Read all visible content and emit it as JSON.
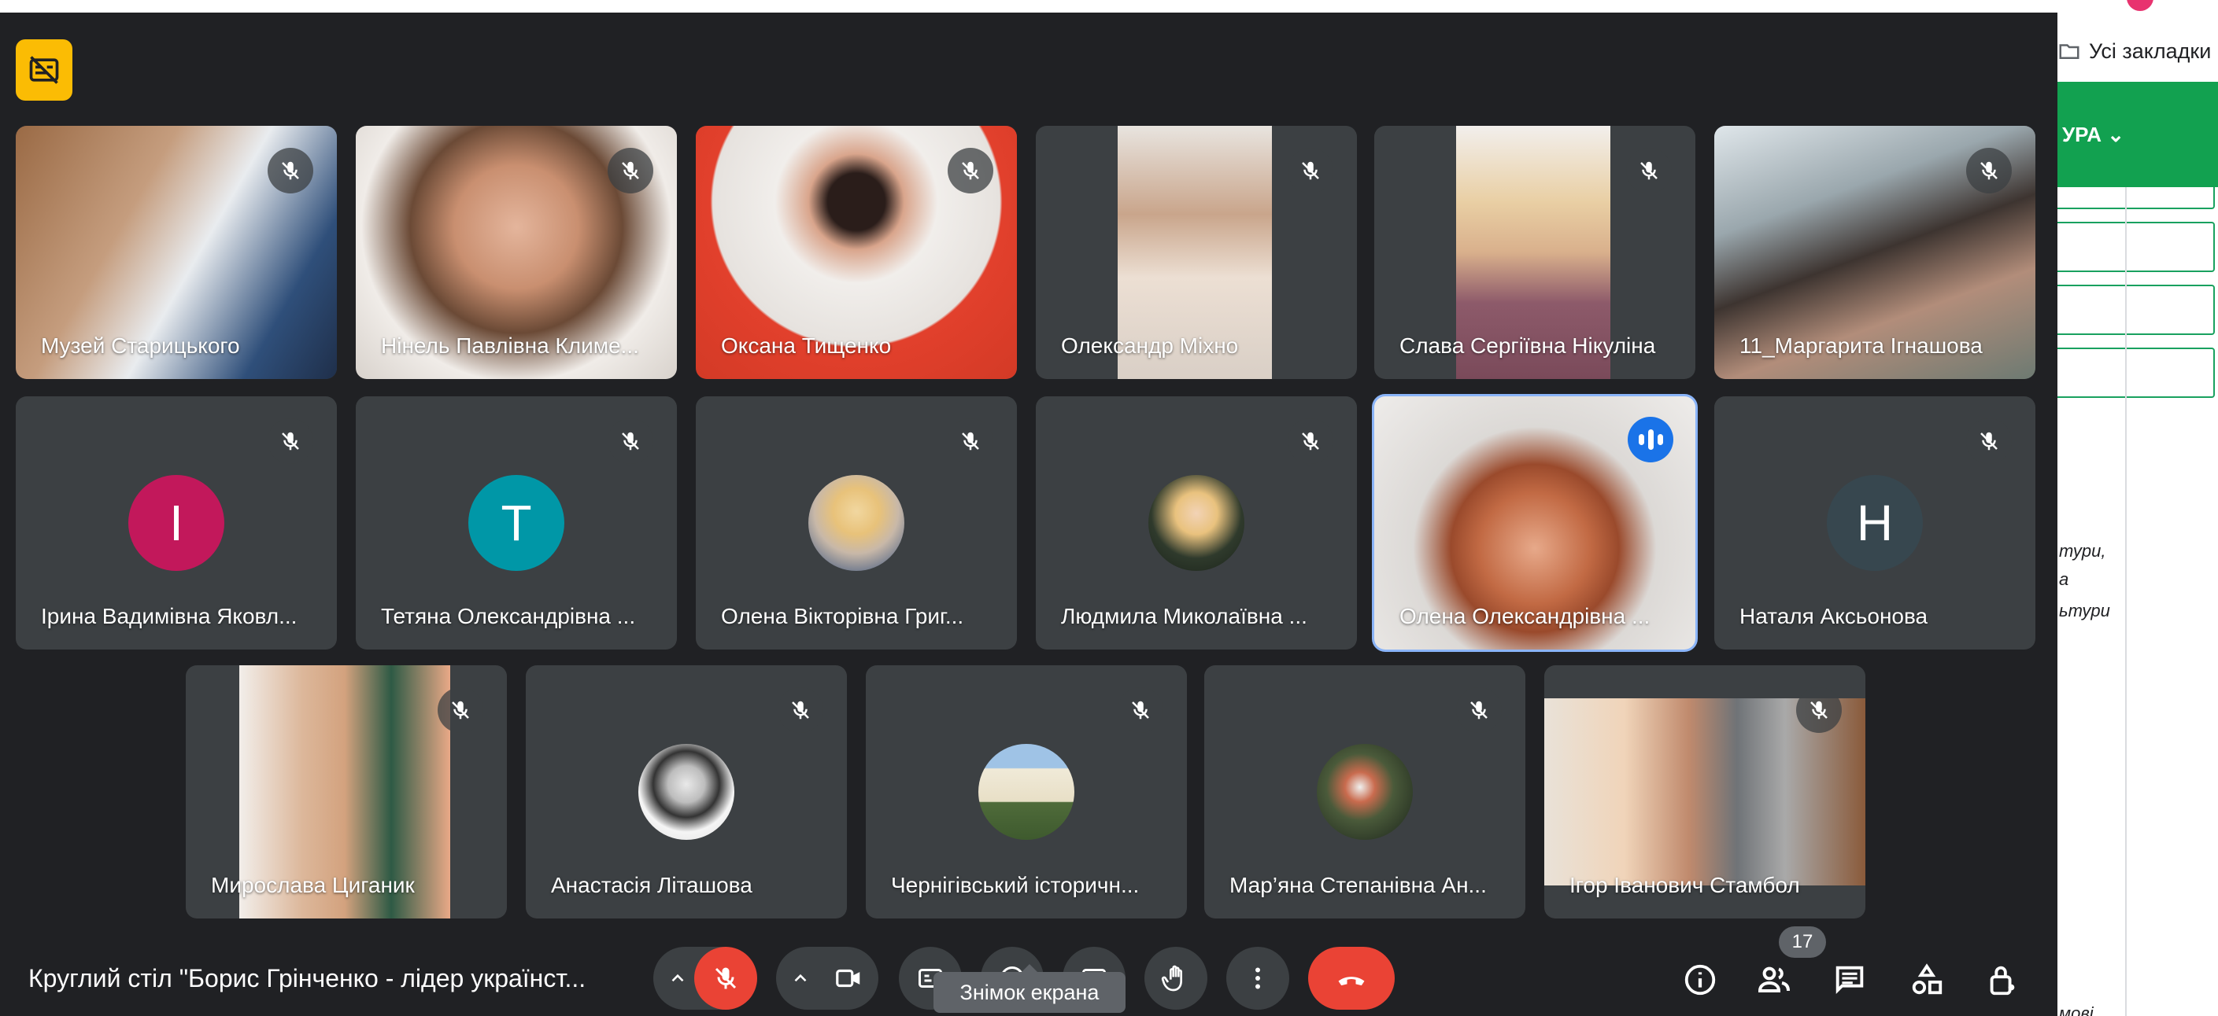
{
  "meeting": {
    "title": "Круглий стіл \"Борис Грінченко - лідер українст...",
    "participant_count": "17",
    "tooltip": "Знімок екрана"
  },
  "participants": [
    {
      "name": "Музей Старицького",
      "muted": true
    },
    {
      "name": "Нінель Павлівна Климе...",
      "muted": true
    },
    {
      "name": "Оксана Тищенко",
      "muted": true
    },
    {
      "name": "Олександр Міхно",
      "muted": true
    },
    {
      "name": "Слава Сергіївна Нікуліна",
      "muted": true
    },
    {
      "name": "11_Маргарита Ігнашова",
      "muted": true
    },
    {
      "name": "Ірина Вадимівна Яковл...",
      "muted": true,
      "initial": "І",
      "avatar_color": "#c2185b"
    },
    {
      "name": "Тетяна Олександрівна ...",
      "muted": true,
      "initial": "T",
      "avatar_color": "#0097a7"
    },
    {
      "name": "Олена Вікторівна Григ...",
      "muted": true
    },
    {
      "name": "Людмила Миколаївна ...",
      "muted": true
    },
    {
      "name": "Олена Олександрівна ...",
      "muted": false,
      "speaking": true
    },
    {
      "name": "Наталя Аксьонова",
      "muted": true,
      "initial": "Н",
      "avatar_color": "#37474f"
    },
    {
      "name": "Мирослава Циганик",
      "muted": true
    },
    {
      "name": "Анастасія Літашова",
      "muted": true
    },
    {
      "name": "Чернігівський історичн...",
      "muted": true
    },
    {
      "name": "Мар’яна Степанівна Ан...",
      "muted": true
    },
    {
      "name": "Ігор Іванович Стамбол",
      "muted": true
    }
  ],
  "browser_side": {
    "bookmarks_label": "Усі закладки",
    "green_menu_label": "УРА ⌄",
    "text_lines": [
      "тури,",
      "а",
      "ьтури",
      "мові"
    ]
  },
  "colors": {
    "meet_bg": "#202124",
    "tile_bg": "#3c4043",
    "end_call": "#ea4335",
    "speaking_outline": "#8ab4f8",
    "captions": "#fbbc04",
    "site_green": "#12a150"
  }
}
